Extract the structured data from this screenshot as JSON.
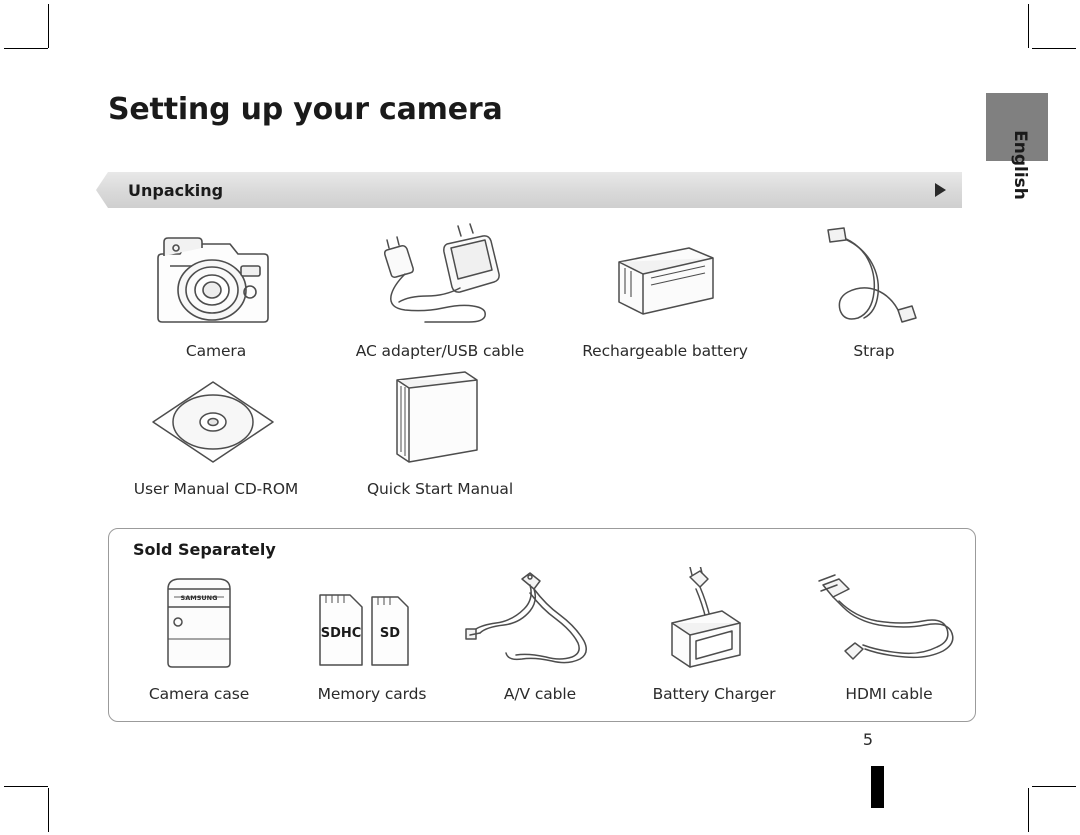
{
  "page": {
    "title": "Setting up your camera",
    "side_tab_label": "English",
    "page_number": "5"
  },
  "section": {
    "label": "Unpacking"
  },
  "unpacking": {
    "row1": [
      {
        "caption": "Camera",
        "icon": "camera-icon"
      },
      {
        "caption": "AC adapter/USB cable",
        "icon": "ac-adapter-usb-cable-icon"
      },
      {
        "caption": "Rechargeable battery",
        "icon": "battery-icon"
      },
      {
        "caption": "Strap",
        "icon": "strap-icon"
      }
    ],
    "row2": [
      {
        "caption": "User Manual CD-ROM",
        "icon": "cd-rom-icon"
      },
      {
        "caption": "Quick Start Manual",
        "icon": "manual-booklet-icon"
      }
    ]
  },
  "sold_separately": {
    "title": "Sold Separately",
    "items": [
      {
        "caption": "Camera case",
        "icon": "camera-case-icon",
        "brand": "SAMSUNG"
      },
      {
        "caption": "Memory cards",
        "icon": "memory-cards-icon",
        "card_labels": [
          "SDHC",
          "SD"
        ]
      },
      {
        "caption": "A/V cable",
        "icon": "av-cable-icon"
      },
      {
        "caption": "Battery Charger",
        "icon": "battery-charger-icon"
      },
      {
        "caption": "HDMI cable",
        "icon": "hdmi-cable-icon"
      }
    ]
  },
  "colors": {
    "text": "#2b2b2b",
    "line": "#4d4d4d",
    "bar_fill": "#d9d9d9",
    "tab_fill": "#808080"
  }
}
